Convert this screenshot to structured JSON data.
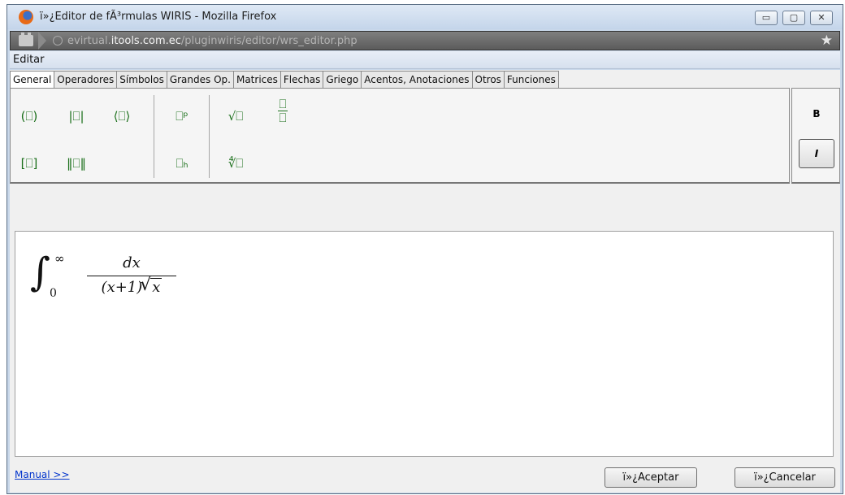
{
  "window": {
    "title": "ï»¿Editor de fÃ³rmulas WIRIS - Mozilla Firefox",
    "controls": [
      "minimize",
      "maximize",
      "close"
    ]
  },
  "address_bar": {
    "prefix": "evirtual.",
    "domain": "itools.com.ec",
    "path": "/pluginwiris/editor/wrs_editor.php"
  },
  "menu": {
    "items": [
      "Editar"
    ]
  },
  "tabs": [
    "General",
    "Operadores",
    "Símbolos",
    "Grandes Op.",
    "Matrices",
    "Flechas",
    "Griego",
    "Acentos, Anotaciones",
    "Otros",
    "Funciones"
  ],
  "active_tab": "General",
  "toolbar": {
    "parentheses": "(⎕)",
    "brackets": "[⎕]",
    "abs": "|⎕|",
    "norm": "‖⎕‖",
    "angle": "⟨⎕⟩",
    "superscript": "⎕ᵖ",
    "subscript": "⎕ₕ",
    "sqrt": "√⎕",
    "nroot": "∜⎕",
    "fraction_top": "⎕",
    "fraction_bottom": "⎕"
  },
  "style": {
    "bold": "B",
    "italic": "I"
  },
  "formula": {
    "integral": "∫",
    "upper_limit": "∞",
    "lower_limit": "0",
    "numerator": "dx",
    "denominator_open": "(x+1)",
    "denominator_root": "x"
  },
  "footer": {
    "manual_link": "Manual >>",
    "accept": "ï»¿Aceptar",
    "cancel": "ï»¿Cancelar"
  }
}
